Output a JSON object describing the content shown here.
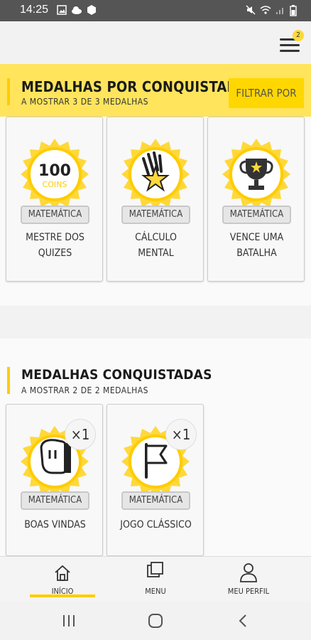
{
  "status": {
    "time": "14:25"
  },
  "header": {
    "notification_count": "2"
  },
  "unearned": {
    "title": "MEDALHAS POR CONQUISTAR",
    "subtitle": "A MOSTRAR 3 DE 3 MEDALHAS",
    "filter_label": "FILTRAR POR",
    "items": [
      {
        "tag": "MATEMÁTICA",
        "title_line1": "MESTRE DOS",
        "title_line2": "QUIZES",
        "badge_text": "100",
        "badge_sub": "COINS",
        "icon": "coins-icon"
      },
      {
        "tag": "MATEMÁTICA",
        "title_line1": "CÁLCULO",
        "title_line2": "MENTAL",
        "icon": "hand-star-icon"
      },
      {
        "tag": "MATEMÁTICA",
        "title_line1": "VENCE UMA",
        "title_line2": "BATALHA",
        "icon": "trophy-icon"
      }
    ]
  },
  "earned": {
    "title": "MEDALHAS CONQUISTADAS",
    "subtitle": "A MOSTRAR 2 DE 2 MEDALHAS",
    "items": [
      {
        "tag": "MATEMÁTICA",
        "title": "BOAS VINDAS",
        "count": "×1",
        "icon": "waving-hand-icon"
      },
      {
        "tag": "MATEMÁTICA",
        "title": "JOGO CLÁSSICO",
        "count": "×1",
        "icon": "flag-icon"
      }
    ]
  },
  "bottom_nav": [
    {
      "label": "INÍCIO",
      "icon": "home-icon"
    },
    {
      "label": "MENU",
      "icon": "cards-icon"
    },
    {
      "label": "MEU PERFIL",
      "icon": "person-icon"
    }
  ],
  "colors": {
    "accent": "#ffd700",
    "header_bg": "#ffe45c",
    "badge": "#ffd83a"
  }
}
